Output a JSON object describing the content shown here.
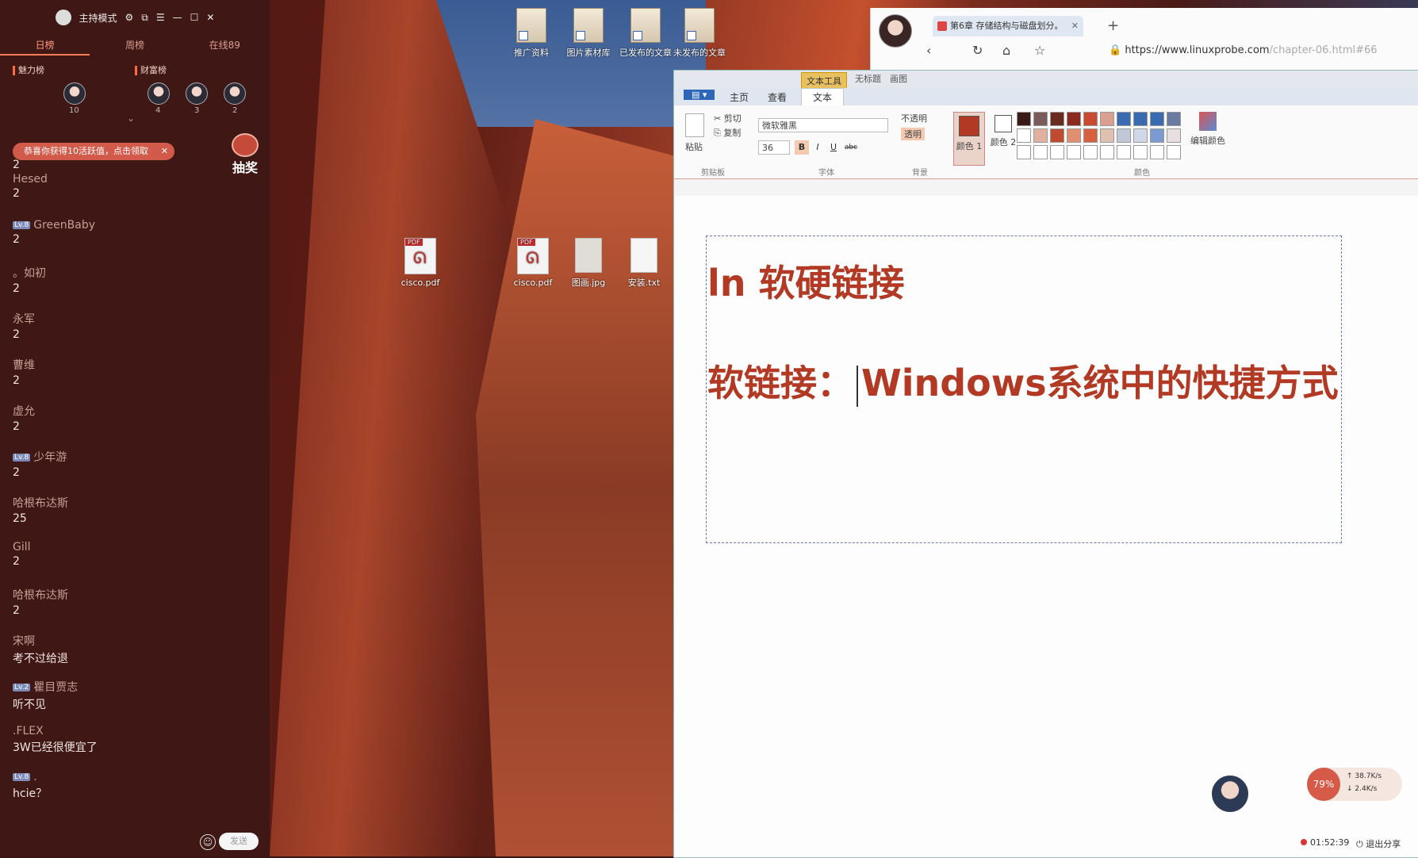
{
  "host_bar": {
    "mode_label": "主持模式"
  },
  "tabs": [
    "日榜",
    "周榜",
    "在线89"
  ],
  "rank": {
    "charm_label": "魅力榜",
    "wealth_label": "财富榜",
    "charm_counts": [
      "10"
    ],
    "wealth_counts": [
      "4",
      "3",
      "2"
    ]
  },
  "notice": {
    "text": "恭喜你获得10活跃值，点击领取",
    "close": "✕"
  },
  "lottery": {
    "label": "抽奖"
  },
  "chat": [
    {
      "badge": "",
      "user": "",
      "text": "2"
    },
    {
      "badge": "",
      "user": "Hesed",
      "text": "2"
    },
    {
      "badge": "Lv.8",
      "user": "GreenBaby",
      "text": "2"
    },
    {
      "badge": "",
      "user": "。如初",
      "text": "2"
    },
    {
      "badge": "",
      "user": "永军",
      "text": "2"
    },
    {
      "badge": "",
      "user": "曹维",
      "text": "2"
    },
    {
      "badge": "",
      "user": "虚允",
      "text": "2"
    },
    {
      "badge": "Lv.8",
      "user": "少年游",
      "text": "2"
    },
    {
      "badge": "",
      "user": "哈根布达斯",
      "text": "25"
    },
    {
      "badge": "",
      "user": "Gill",
      "text": "2"
    },
    {
      "badge": "",
      "user": "哈根布达斯",
      "text": "2"
    },
    {
      "badge": "",
      "user": "宋啊",
      "text": "考不过给退"
    },
    {
      "badge": "Lv.2",
      "user": "瞿目贾志",
      "text": "听不见"
    },
    {
      "badge": "",
      "user": ".FLEX",
      "text": "3W已经很便宜了"
    },
    {
      "badge": "Lv.8",
      "user": ".",
      "text": "hcie？"
    }
  ],
  "chat_input": {
    "send": "发送"
  },
  "desktop_icons": [
    {
      "label": "推广资料",
      "kind": "folder"
    },
    {
      "label": "图片素材库",
      "kind": "folder"
    },
    {
      "label": "已发布的文章",
      "kind": "folder"
    },
    {
      "label": "未发布的文章",
      "kind": "folder"
    },
    {
      "label": "cisco.pdf",
      "kind": "pdf"
    },
    {
      "label": "cisco.pdf",
      "kind": "pdf"
    },
    {
      "label": "图画.jpg",
      "kind": "image"
    },
    {
      "label": "安装.txt",
      "kind": "txt"
    }
  ],
  "browser": {
    "tab_title": "第6章 存储结构与磁盘划分。",
    "url_main": "https://www.linuxprobe.com",
    "url_rest": "/chapter-06.html#66"
  },
  "paint": {
    "context_tab": "文本工具",
    "title_extra1": "无标题",
    "title_extra2": "画图",
    "tabs": [
      "主页",
      "查看",
      "文本"
    ],
    "clipboard": {
      "paste": "粘贴",
      "cut": "剪切",
      "copy": "复制",
      "group": "剪贴板"
    },
    "font": {
      "family": "微软雅黑",
      "size": "36",
      "bold": "B",
      "italic": "I",
      "underline": "U",
      "strike": "abc",
      "group": "字体"
    },
    "background": {
      "opaque": "不透明",
      "transparent": "透明",
      "group": "背景"
    },
    "colors": {
      "color1": "颜色 1",
      "color2": "颜色 2",
      "edit": "编辑颜色",
      "group": "颜色"
    },
    "palette": [
      "#3a1a16",
      "#7a5a5a",
      "#6b2a20",
      "#8a2a20",
      "#c84a30",
      "#d8a090",
      "#3a6ab0",
      "#3a6ab0",
      "#3a6ab0",
      "#6a7aa0",
      "#ffffff",
      "#e0b0a0",
      "#c04a30",
      "#e09070",
      "#d86040",
      "#e0c0b0",
      "#c0c8d8",
      "#d0d8e8",
      "#7a9ad0",
      "#e8e0e0"
    ],
    "canvas_line1": "ln  软硬链接",
    "canvas_line2a": "软链接：",
    "canvas_line2b": "Windows系统中的快捷方式"
  },
  "stats": {
    "percent": "79%",
    "up": "38.7K/s",
    "down": "2.4K/s",
    "timer": "01:52:39",
    "exit": "退出分享"
  }
}
